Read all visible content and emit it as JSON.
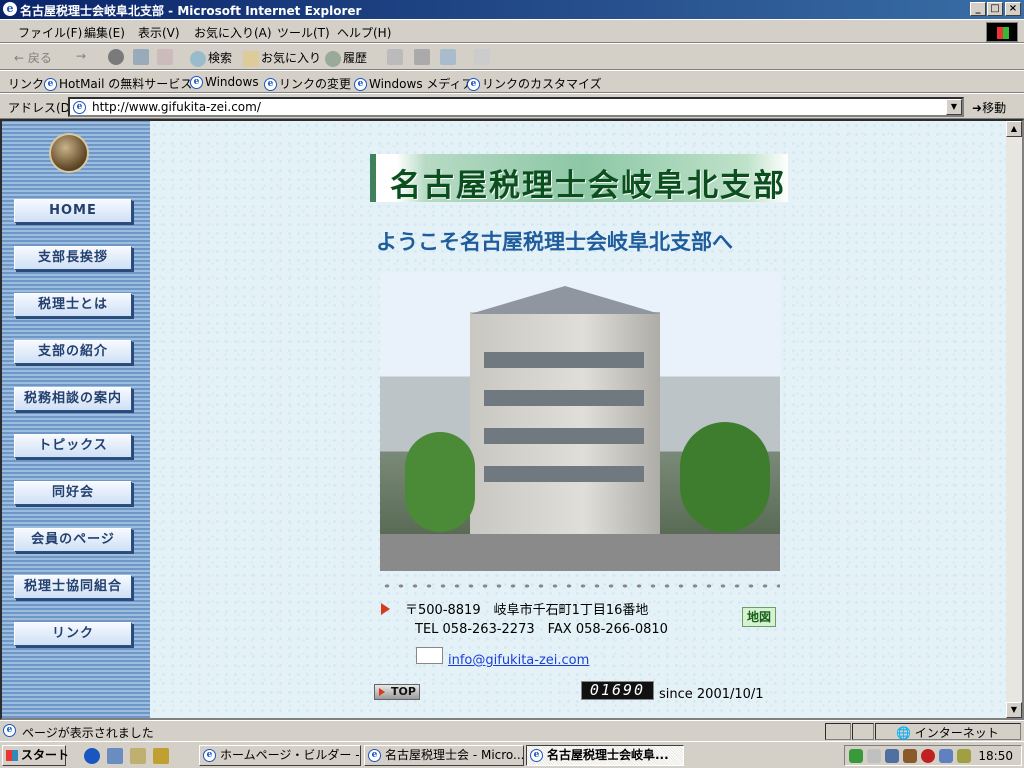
{
  "window": {
    "title": "名古屋税理士会岐阜北支部 - Microsoft Internet Explorer",
    "btn_min": "_",
    "btn_max": "□",
    "btn_close": "×"
  },
  "menu": {
    "items": [
      "ファイル(F)",
      "編集(E)",
      "表示(V)",
      "お気に入り(A)",
      "ツール(T)",
      "ヘルプ(H)"
    ]
  },
  "toolbar": {
    "back": "← 戻る",
    "forward": "→",
    "search": "検索",
    "favorites": "お気に入り",
    "history": "履歴"
  },
  "links": {
    "label": "リンク",
    "items": [
      "HotMail の無料サービス",
      "Windows",
      "リンクの変更",
      "Windows メディア",
      "リンクのカスタマイズ"
    ]
  },
  "address": {
    "label": "アドレス(D)",
    "url": "http://www.gifukita-zei.com/",
    "go": "移動"
  },
  "sidebar": {
    "nav": [
      "HOME",
      "支部長挨拶",
      "税理士とは",
      "支部の紹介",
      "税務相談の案内",
      "トピックス",
      "同好会",
      "会員のページ",
      "税理士協同組合",
      "リンク"
    ]
  },
  "page": {
    "banner": "名古屋税理士会岐阜北支部",
    "welcome": "ようこそ名古屋税理士会岐阜北支部へ",
    "address_line": "〒500-8819　岐阜市千石町1丁目16番地",
    "tel_line": "TEL 058-263-2273　FAX 058-266-0810",
    "map_button": "地図",
    "email": "info@gifukita-zei.com",
    "top_button": "TOP",
    "counter": "01690",
    "since": "since 2001/10/1"
  },
  "status": {
    "text": "ページが表示されました",
    "zone": "インターネット"
  },
  "taskbar": {
    "start": "スタート",
    "tasks": [
      "ホームページ・ビルダー - [i...",
      "名古屋税理士会 - Micro...",
      "名古屋税理士会岐阜..."
    ],
    "clock": "18:50"
  },
  "colors": {
    "titlebar": "#0a246a",
    "nav_text": "#23406f",
    "banner_text": "#0b4f1f",
    "welcome_text": "#1f5c9c",
    "link": "#1a3fd8"
  }
}
